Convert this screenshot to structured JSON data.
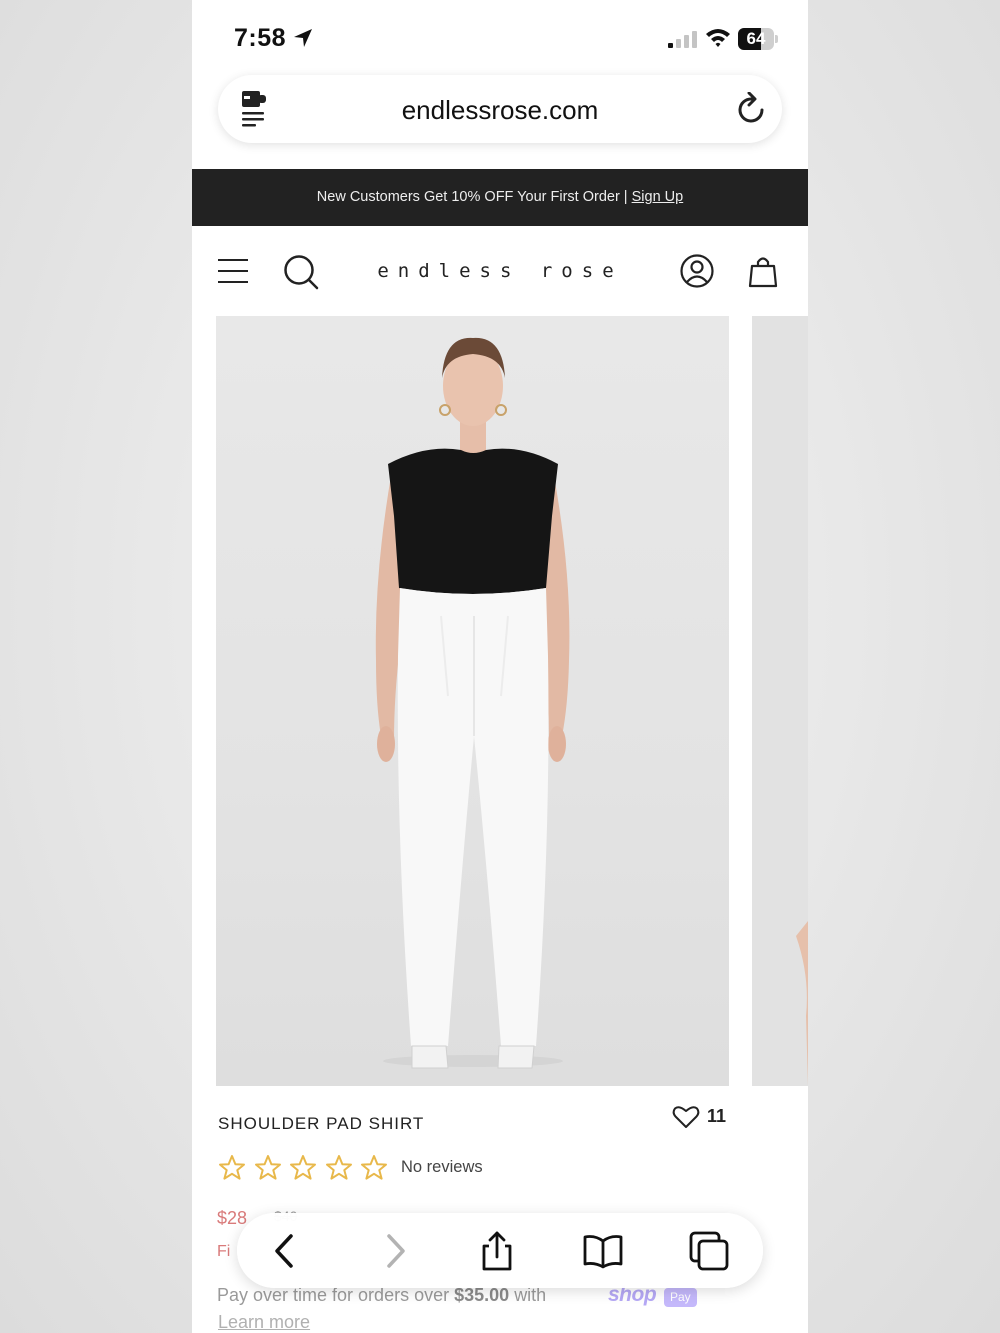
{
  "status_bar": {
    "time": "7:58",
    "battery_level": "64",
    "icons": [
      "location-arrow-icon",
      "cellular-signal-icon",
      "wifi-icon",
      "battery-icon"
    ]
  },
  "browser": {
    "url": "endlessrose.com",
    "icons": [
      "page-format-icon",
      "reload-icon"
    ]
  },
  "promo_banner": {
    "text": "New Customers Get 10% OFF Your First Order |",
    "link": "Sign Up"
  },
  "site_header": {
    "brand": "endless rose",
    "icons": [
      "menu-icon",
      "search-icon",
      "account-icon",
      "shopping-bag-icon"
    ]
  },
  "product": {
    "title": "SHOULDER PAD SHIRT",
    "favorites_count": "11",
    "rating_stars": 0,
    "rating_max": 5,
    "reviews_text": "No reviews",
    "price": "$28",
    "original_price": "$40",
    "financing_text": "Fi",
    "pay_over_time": {
      "prefix": "Pay over time for orders over",
      "amount": "$35.00",
      "suffix": "with",
      "brand": "shop",
      "badge": "Pay",
      "learn_more": "Learn more"
    }
  },
  "toolbar": {
    "icons": [
      "back-icon",
      "forward-icon",
      "share-icon",
      "bookmarks-icon",
      "tabs-icon"
    ]
  },
  "colors": {
    "banner_bg": "#222222",
    "price": "#d97a7a",
    "star": "#e8b84a",
    "shop_pay": "#b5a8f5"
  }
}
